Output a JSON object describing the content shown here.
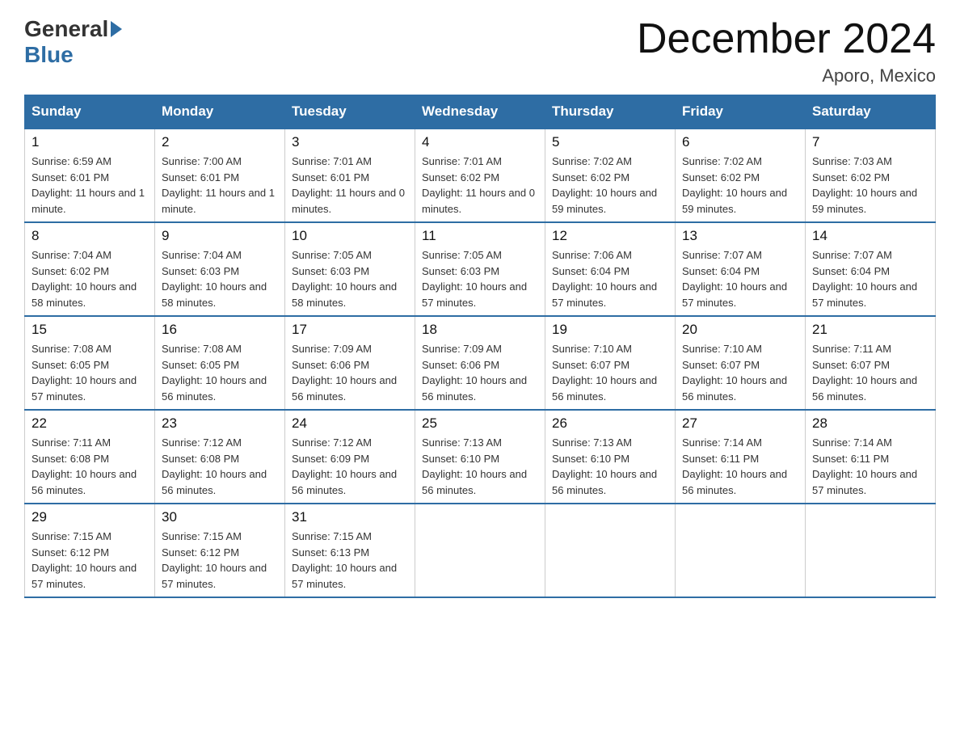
{
  "header": {
    "logo_general": "General",
    "logo_blue": "Blue",
    "title": "December 2024",
    "location": "Aporo, Mexico"
  },
  "days_of_week": [
    "Sunday",
    "Monday",
    "Tuesday",
    "Wednesday",
    "Thursday",
    "Friday",
    "Saturday"
  ],
  "weeks": [
    [
      {
        "day": "1",
        "sunrise": "6:59 AM",
        "sunset": "6:01 PM",
        "daylight": "11 hours and 1 minute."
      },
      {
        "day": "2",
        "sunrise": "7:00 AM",
        "sunset": "6:01 PM",
        "daylight": "11 hours and 1 minute."
      },
      {
        "day": "3",
        "sunrise": "7:01 AM",
        "sunset": "6:01 PM",
        "daylight": "11 hours and 0 minutes."
      },
      {
        "day": "4",
        "sunrise": "7:01 AM",
        "sunset": "6:02 PM",
        "daylight": "11 hours and 0 minutes."
      },
      {
        "day": "5",
        "sunrise": "7:02 AM",
        "sunset": "6:02 PM",
        "daylight": "10 hours and 59 minutes."
      },
      {
        "day": "6",
        "sunrise": "7:02 AM",
        "sunset": "6:02 PM",
        "daylight": "10 hours and 59 minutes."
      },
      {
        "day": "7",
        "sunrise": "7:03 AM",
        "sunset": "6:02 PM",
        "daylight": "10 hours and 59 minutes."
      }
    ],
    [
      {
        "day": "8",
        "sunrise": "7:04 AM",
        "sunset": "6:02 PM",
        "daylight": "10 hours and 58 minutes."
      },
      {
        "day": "9",
        "sunrise": "7:04 AM",
        "sunset": "6:03 PM",
        "daylight": "10 hours and 58 minutes."
      },
      {
        "day": "10",
        "sunrise": "7:05 AM",
        "sunset": "6:03 PM",
        "daylight": "10 hours and 58 minutes."
      },
      {
        "day": "11",
        "sunrise": "7:05 AM",
        "sunset": "6:03 PM",
        "daylight": "10 hours and 57 minutes."
      },
      {
        "day": "12",
        "sunrise": "7:06 AM",
        "sunset": "6:04 PM",
        "daylight": "10 hours and 57 minutes."
      },
      {
        "day": "13",
        "sunrise": "7:07 AM",
        "sunset": "6:04 PM",
        "daylight": "10 hours and 57 minutes."
      },
      {
        "day": "14",
        "sunrise": "7:07 AM",
        "sunset": "6:04 PM",
        "daylight": "10 hours and 57 minutes."
      }
    ],
    [
      {
        "day": "15",
        "sunrise": "7:08 AM",
        "sunset": "6:05 PM",
        "daylight": "10 hours and 57 minutes."
      },
      {
        "day": "16",
        "sunrise": "7:08 AM",
        "sunset": "6:05 PM",
        "daylight": "10 hours and 56 minutes."
      },
      {
        "day": "17",
        "sunrise": "7:09 AM",
        "sunset": "6:06 PM",
        "daylight": "10 hours and 56 minutes."
      },
      {
        "day": "18",
        "sunrise": "7:09 AM",
        "sunset": "6:06 PM",
        "daylight": "10 hours and 56 minutes."
      },
      {
        "day": "19",
        "sunrise": "7:10 AM",
        "sunset": "6:07 PM",
        "daylight": "10 hours and 56 minutes."
      },
      {
        "day": "20",
        "sunrise": "7:10 AM",
        "sunset": "6:07 PM",
        "daylight": "10 hours and 56 minutes."
      },
      {
        "day": "21",
        "sunrise": "7:11 AM",
        "sunset": "6:07 PM",
        "daylight": "10 hours and 56 minutes."
      }
    ],
    [
      {
        "day": "22",
        "sunrise": "7:11 AM",
        "sunset": "6:08 PM",
        "daylight": "10 hours and 56 minutes."
      },
      {
        "day": "23",
        "sunrise": "7:12 AM",
        "sunset": "6:08 PM",
        "daylight": "10 hours and 56 minutes."
      },
      {
        "day": "24",
        "sunrise": "7:12 AM",
        "sunset": "6:09 PM",
        "daylight": "10 hours and 56 minutes."
      },
      {
        "day": "25",
        "sunrise": "7:13 AM",
        "sunset": "6:10 PM",
        "daylight": "10 hours and 56 minutes."
      },
      {
        "day": "26",
        "sunrise": "7:13 AM",
        "sunset": "6:10 PM",
        "daylight": "10 hours and 56 minutes."
      },
      {
        "day": "27",
        "sunrise": "7:14 AM",
        "sunset": "6:11 PM",
        "daylight": "10 hours and 56 minutes."
      },
      {
        "day": "28",
        "sunrise": "7:14 AM",
        "sunset": "6:11 PM",
        "daylight": "10 hours and 57 minutes."
      }
    ],
    [
      {
        "day": "29",
        "sunrise": "7:15 AM",
        "sunset": "6:12 PM",
        "daylight": "10 hours and 57 minutes."
      },
      {
        "day": "30",
        "sunrise": "7:15 AM",
        "sunset": "6:12 PM",
        "daylight": "10 hours and 57 minutes."
      },
      {
        "day": "31",
        "sunrise": "7:15 AM",
        "sunset": "6:13 PM",
        "daylight": "10 hours and 57 minutes."
      },
      null,
      null,
      null,
      null
    ]
  ]
}
